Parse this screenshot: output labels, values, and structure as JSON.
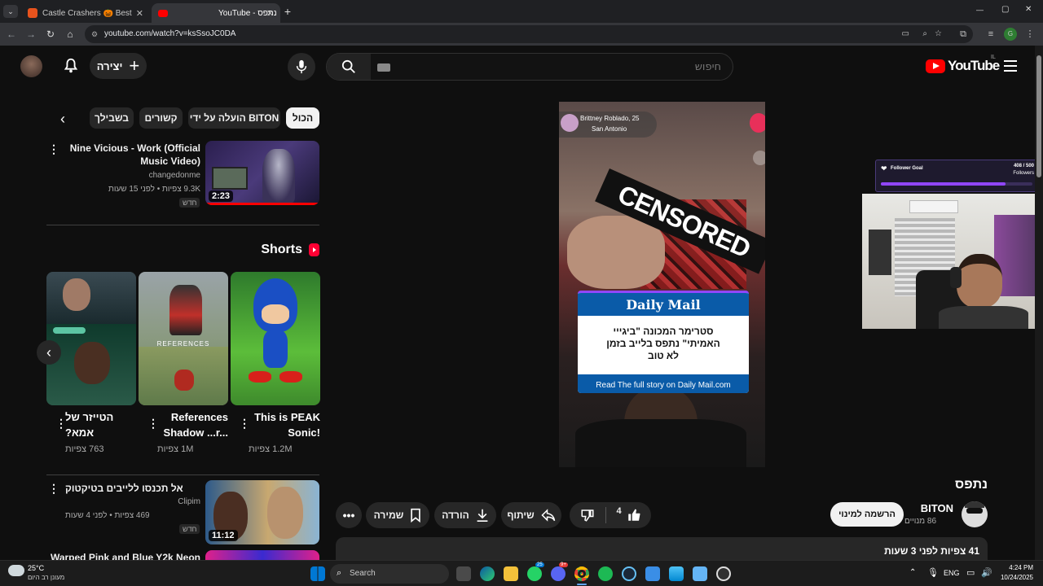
{
  "browser": {
    "tabs": [
      {
        "title": "Castle Crashers 🎃 Best Prices",
        "active": false
      },
      {
        "title": "YouTube - נתפס",
        "active": true
      }
    ],
    "new_tab": "+",
    "url": "youtube.com/watch?v=ksSsoJC0DA",
    "window_controls": {
      "minimize": "—",
      "maximize": "▢",
      "close": "✕"
    }
  },
  "youtube": {
    "logo_text": "YouTube",
    "region": "IL",
    "search_placeholder": "חיפוש",
    "create_label": "יצירה",
    "filters": [
      "הכול",
      "הועלה על ידי BITON",
      "קשורים",
      "בשבילך"
    ],
    "recommended": [
      {
        "title_line1": "Nine Vicious - Work (Official",
        "title_line2": "Music Video)",
        "channel": "changedonme",
        "meta": "9.3K צפיות • לפני 15 שעות",
        "badge": "חדש",
        "duration": "2:23"
      },
      {
        "title_line1": "אל תכנסו ללייבים בטיקטוק",
        "title_line2": "",
        "channel": "Clipim",
        "meta": "469 צפיות • לפני 4 שעות",
        "badge": "חדש",
        "duration": "11:12"
      },
      {
        "title_line1": "Warped Pink and Blue Y2k Neon",
        "title_line2": "",
        "channel": "",
        "meta": "",
        "badge": "",
        "duration": ""
      }
    ],
    "shorts_heading": "Shorts",
    "shorts": [
      {
        "title_line1": "This is PEAK",
        "title_line2": "Sonic!",
        "views": "1.2M צפיות"
      },
      {
        "title_line1": "References",
        "title_line2": "Shadow ...r...",
        "views": "1M צפיות",
        "overlay": "REFERENCES"
      },
      {
        "title_line1": "הטייזר של",
        "title_line2": "אמא?",
        "views": "763 צפיות"
      }
    ],
    "video": {
      "title": "נתפס",
      "channel": "BITON",
      "subscribers": "86 מנויים",
      "subscribe_label": "הרשמה למינוי",
      "likes": "4",
      "share_label": "שיתוף",
      "download_label": "הורדה",
      "save_label": "שמירה",
      "description_meta": "41 צפיות  לפני 3 שעות",
      "overlay_user": "Brittney Roblado, 25",
      "overlay_location": "San Antonio",
      "censored": "CENSORED",
      "dm_brand": "Daily Mail",
      "dm_headline_line1": "סטרימר המכונה \"ביגייי",
      "dm_headline_line2": "האמיתי\" נתפס בלייב בזמן",
      "dm_headline_line3": "לא טוב",
      "dm_link": "Read The full story on Daily Mail.com"
    },
    "stream_overlay": {
      "goal_label": "Follower Goal",
      "goal_count": "408 / 500",
      "goal_unit": "Followers",
      "goal_progress": 0.82
    }
  },
  "taskbar": {
    "weather_temp": "25°C",
    "weather_desc": "מעונן רב היום",
    "search_label": "Search",
    "lang": "ENG",
    "time": "4:24 PM",
    "date": "10/24/2025",
    "badge_whatsapp": "25",
    "badge_discord": "9+"
  },
  "colors": {
    "accent": "#ff0000",
    "background": "#0f0f0f",
    "chip": "#272727",
    "twitch_purple": "#9146ff",
    "dm_blue": "#0a5ba8"
  }
}
